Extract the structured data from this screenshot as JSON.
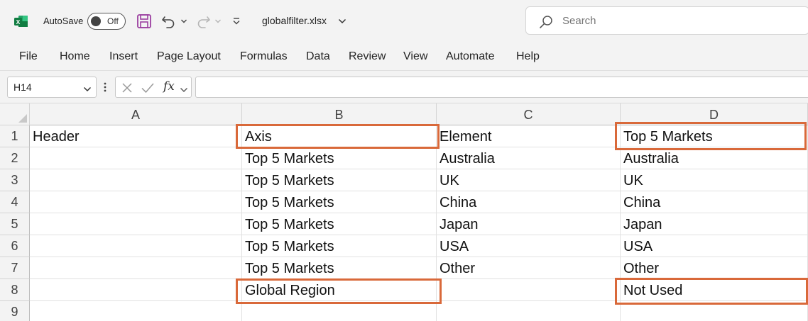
{
  "titlebar": {
    "autosave_label": "AutoSave",
    "autosave_state": "Off",
    "filename": "globalfilter.xlsx",
    "search_placeholder": "Search",
    "accent_color": "#107c41"
  },
  "ribbon": {
    "tabs": [
      {
        "label": "File"
      },
      {
        "label": "Home"
      },
      {
        "label": "Insert"
      },
      {
        "label": "Page Layout"
      },
      {
        "label": "Formulas"
      },
      {
        "label": "Data"
      },
      {
        "label": "Review"
      },
      {
        "label": "View"
      },
      {
        "label": "Automate"
      },
      {
        "label": "Help"
      }
    ]
  },
  "formula_bar": {
    "name_box": "H14",
    "fx_label": "fx",
    "formula": ""
  },
  "sheet": {
    "columns": [
      "A",
      "B",
      "C",
      "D"
    ],
    "rows": [
      "1",
      "2",
      "3",
      "4",
      "5",
      "6",
      "7",
      "8",
      "9"
    ],
    "cells": [
      [
        "Header",
        "Axis",
        "Element",
        "Top 5 Markets"
      ],
      [
        "",
        "Top 5 Markets",
        "Australia",
        "Australia"
      ],
      [
        "",
        "Top 5 Markets",
        "UK",
        "UK"
      ],
      [
        "",
        "Top 5 Markets",
        "China",
        "China"
      ],
      [
        "",
        "Top 5 Markets",
        "Japan",
        "Japan"
      ],
      [
        "",
        "Top 5 Markets",
        "USA",
        "USA"
      ],
      [
        "",
        "Top 5 Markets",
        "Other",
        "Other"
      ],
      [
        "",
        "Global Region",
        "",
        "Not Used"
      ],
      [
        "",
        "",
        "",
        ""
      ]
    ],
    "highlight_color": "#d9693a"
  }
}
